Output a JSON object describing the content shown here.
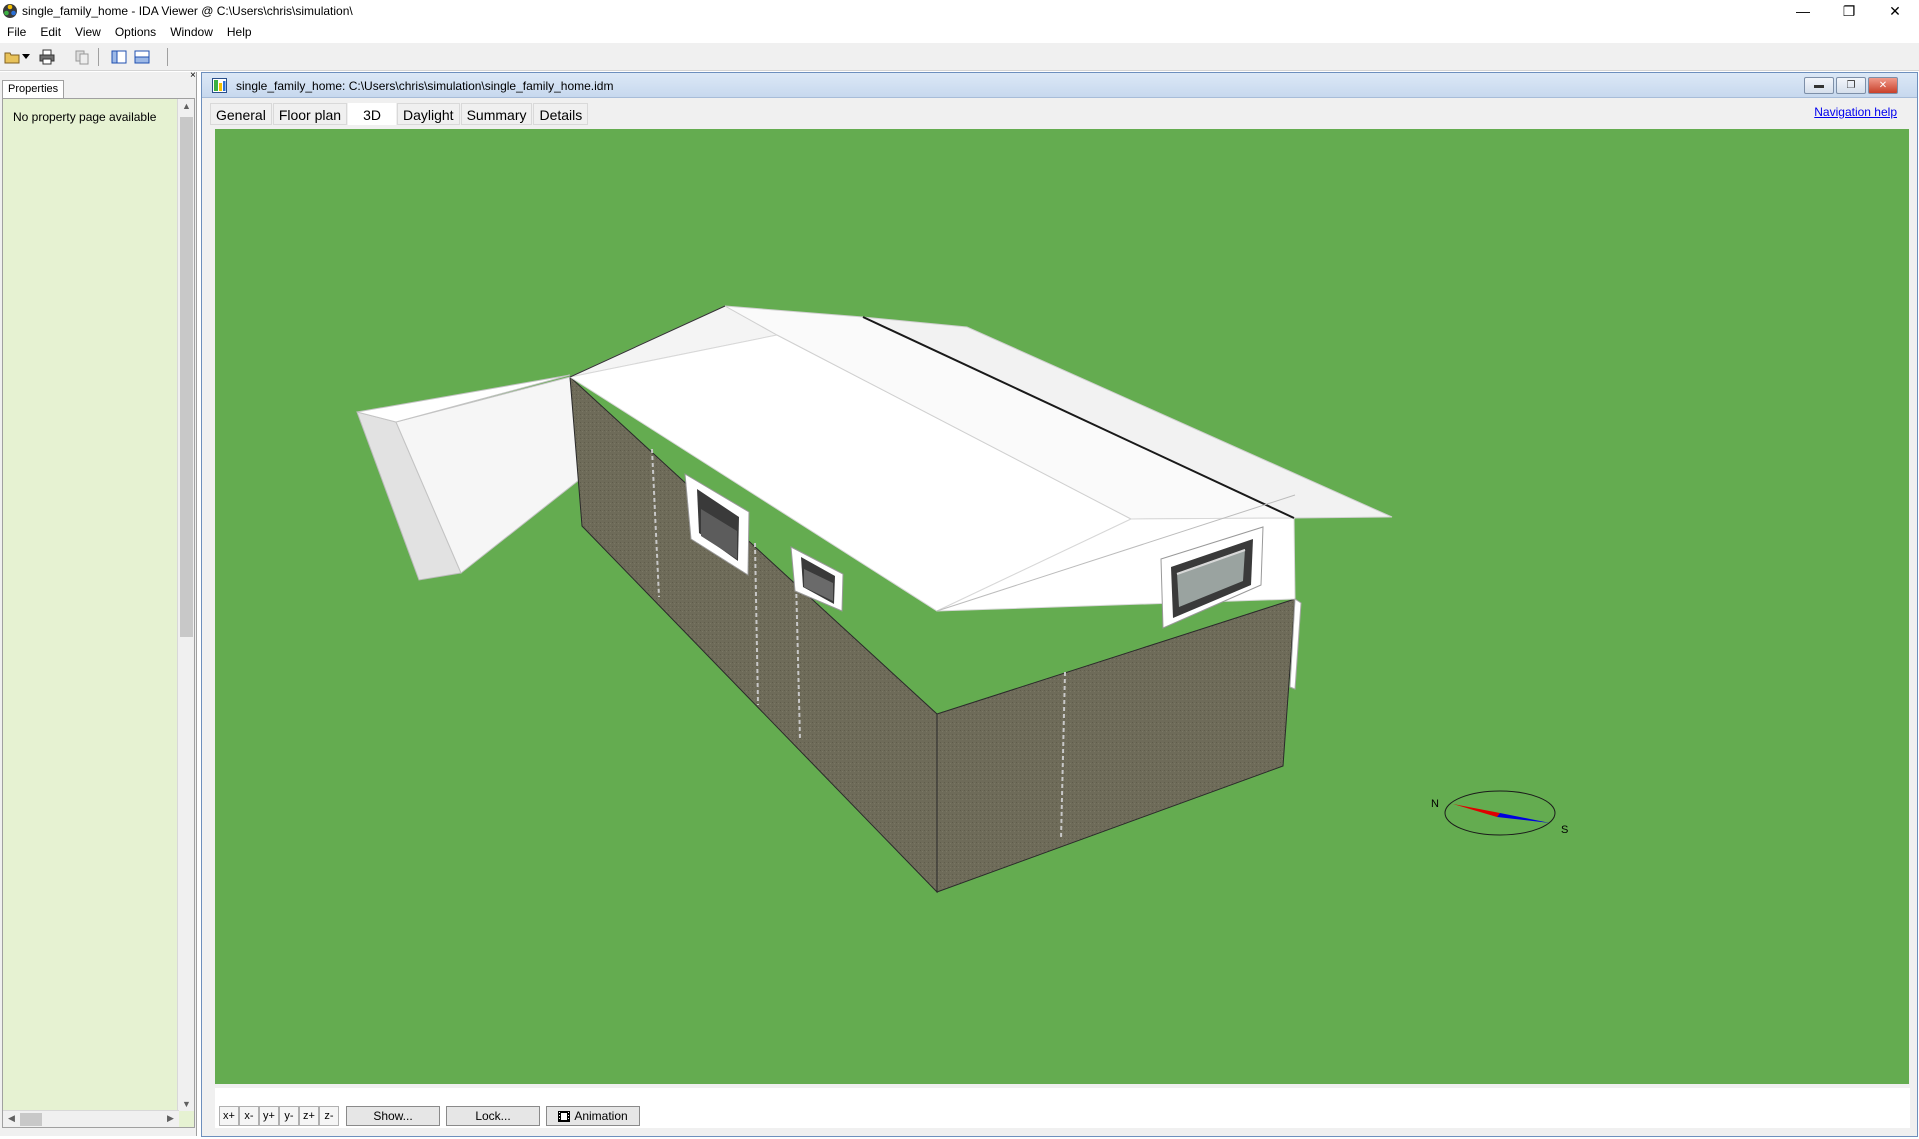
{
  "window": {
    "title": "single_family_home - IDA Viewer @ C:\\Users\\chris\\simulation\\",
    "minimize": "—",
    "restore": "❐",
    "close": "✕"
  },
  "menu": [
    "File",
    "Edit",
    "View",
    "Options",
    "Window",
    "Help"
  ],
  "properties": {
    "tab_label": "Properties",
    "message": "No property page available",
    "close_glyph": "×"
  },
  "document": {
    "title": "single_family_home: C:\\Users\\chris\\simulation\\single_family_home.idm",
    "tabs": [
      "General",
      "Floor plan",
      "3D",
      "Daylight",
      "Summary",
      "Details"
    ],
    "active_tab": "3D",
    "navigation_help": "Navigation help"
  },
  "compass": {
    "north": "N",
    "south": "S"
  },
  "view_controls": {
    "axis_buttons": [
      "x+",
      "x-",
      "y+",
      "y-",
      "z+",
      "z-"
    ],
    "show_label": "Show...",
    "lock_label": "Lock...",
    "animation_label": "Animation"
  },
  "colors": {
    "ground": "#64ac50",
    "wall": "#6e6b59",
    "roof": "#ffffff",
    "panel_bg": "#e6f2d2",
    "compass_north": "#e00000",
    "compass_south": "#0000e0"
  }
}
